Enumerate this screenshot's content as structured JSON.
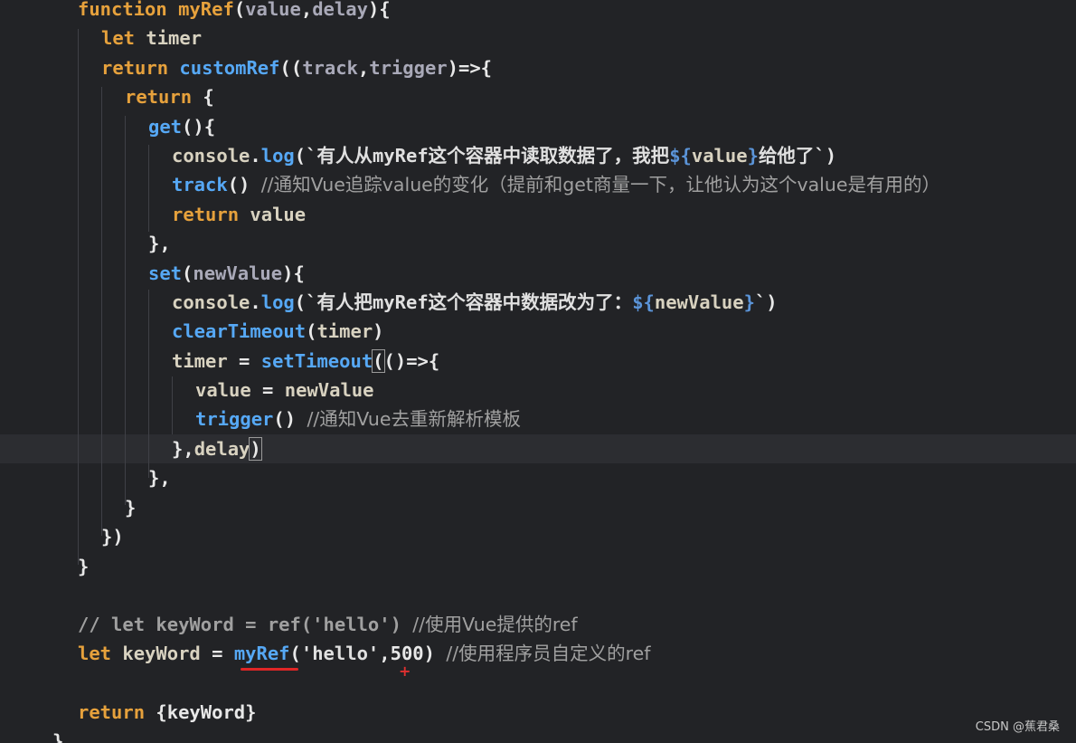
{
  "code": {
    "l1": {
      "kw": "function",
      "name": "myRef",
      "open": "(",
      "p1": "value",
      "comma": ",",
      "p2": "delay",
      "close": "){"
    },
    "l2": {
      "kw": "let",
      "var": "timer"
    },
    "l3": {
      "kw": "return",
      "fn": "customRef",
      "open": "((",
      "p1": "track",
      "comma": ",",
      "p2": "trigger",
      "close": ")=>{"
    },
    "l4": {
      "kw": "return",
      "brace": "{"
    },
    "l5": {
      "fn": "get",
      "rest": "(){"
    },
    "l6": {
      "obj": "console",
      "dot": ".",
      "fn": "log",
      "open": "(`",
      "text": "有人从myRef这个容器中读取数据了，我把",
      "tpl_open": "${",
      "tpl_var": "value",
      "tpl_close": "}",
      "text2": "给他了",
      "close": "`)"
    },
    "l7": {
      "fn": "track",
      "paren": "()",
      "comment": "//通知Vue追踪value的变化（提前和get商量一下，让他认为这个value是有用的）"
    },
    "l8": {
      "kw": "return",
      "var": "value"
    },
    "l9": {
      "punc": "},"
    },
    "l10": {
      "fn": "set",
      "open": "(",
      "param": "newValue",
      "close": "){"
    },
    "l11": {
      "obj": "console",
      "dot": ".",
      "fn": "log",
      "open": "(`",
      "text": "有人把myRef这个容器中数据改为了：",
      "tpl_open": "${",
      "tpl_var": "newValue",
      "tpl_close": "}",
      "close": "`)"
    },
    "l12": {
      "fn": "clearTimeout",
      "open": "(",
      "var": "timer",
      "close": ")"
    },
    "l13": {
      "var": "timer",
      "eq": " = ",
      "fn": "setTimeout",
      "open": "(",
      "rest": "()=>{"
    },
    "l14": {
      "var": "value",
      "eq": " = ",
      "var2": "newValue"
    },
    "l15": {
      "fn": "trigger",
      "paren": "()",
      "comment": "//通知Vue去重新解析模板"
    },
    "l16": {
      "punc": "},",
      "var": "delay",
      "close": ")"
    },
    "l17": {
      "punc": "},"
    },
    "l18": {
      "punc": "}"
    },
    "l19": {
      "punc": "})"
    },
    "l20": {
      "punc": "}"
    },
    "l21": {
      "comment_code": "// let keyWord = ref('hello') ",
      "comment": "//使用Vue提供的ref"
    },
    "l22": {
      "kw": "let",
      "var": "keyWord",
      "eq": " = ",
      "fn": "myRef",
      "open": "(",
      "str": "'hello'",
      "comma": ",",
      "num": "500",
      "close": ")",
      "comment": "//使用程序员自定义的ref"
    },
    "l23": {
      "kw": "return",
      "rest": "{keyWord}"
    },
    "l24": {
      "punc": "}"
    }
  },
  "watermark": "CSDN @蕉君桑",
  "colors": {
    "background": "#222326",
    "keyword": "#e6a13c",
    "call": "#56a8f5",
    "comment": "#a0a0a0",
    "error_underline": "#e02626"
  }
}
